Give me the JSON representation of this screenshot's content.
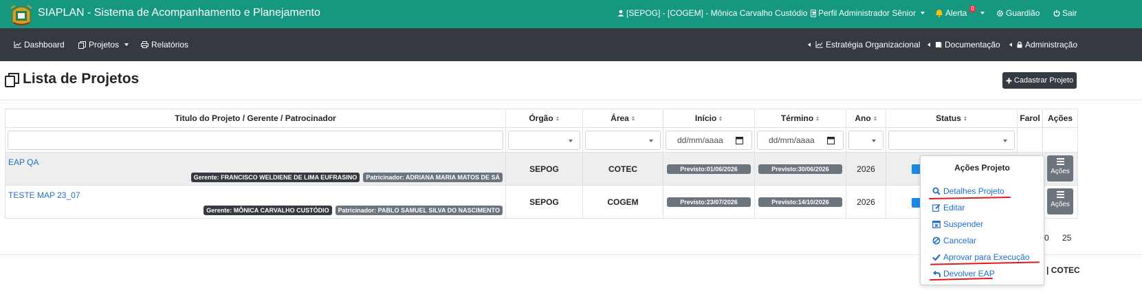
{
  "topbar": {
    "app_title": "SIAPLAN - Sistema de Acompanhamento e Planejamento",
    "user": "[SEPOG] - [COGEM] - Mônica Carvalho Custódio",
    "profile": "Perfil Administrador Sênior",
    "alert": "Alerta",
    "alert_count": "0",
    "guardiao": "Guardião",
    "exit": "Sair"
  },
  "navbar": {
    "dashboard": "Dashboard",
    "projetos": "Projetos",
    "relatorios": "Relatórios",
    "estrategia": "Estratégia Organizacional",
    "documentacao": "Documentação",
    "administracao": "Administração"
  },
  "page": {
    "title": "Lista de Projetos",
    "add_button": "Cadastrar Projeto"
  },
  "table": {
    "headers": [
      "Titulo do Projeto / Gerente / Patrocinador",
      "Órgão",
      "Área",
      "Início",
      "Término",
      "Ano",
      "Status",
      "Farol",
      "Ações"
    ],
    "date_placeholder": "dd/mm/aaaa",
    "rows": [
      {
        "title": "EAP QA",
        "gerente": "Gerente: FRANCISCO WELDIENE DE LIMA EUFRASINO",
        "patrocinador": "Patricinador: ADRIANA MARIA MATOS DE SÁ",
        "orgao": "SEPOG",
        "area": "COTEC",
        "inicio": "Previsto:01/06/2026",
        "termino": "Previsto:30/06/2026",
        "ano": "2026",
        "acoes": "Ações"
      },
      {
        "title": "TESTE MAP 23_07",
        "gerente": "Gerente: MÔNICA CARVALHO CUSTÓDIO",
        "patrocinador": "Patricinador: PABLO SAMUEL SILVA DO NASCIMENTO",
        "orgao": "SEPOG",
        "area": "COGEM",
        "inicio": "Previsto:23/07/2026",
        "termino": "Previsto:14/10/2026",
        "ano": "2026",
        "acoes": "Ações"
      }
    ]
  },
  "dropdown": {
    "header": "Ações Projeto",
    "items": [
      "Detalhes Projeto",
      "Editar",
      "Suspender",
      "Cancelar",
      "Aprovar para Execução",
      "Devolver EAP"
    ]
  },
  "pagination": {
    "a": "0",
    "b": "25"
  },
  "footer": {
    "text": "| COTEC"
  },
  "colors": {
    "topbar": "#16977f",
    "navbar": "#343a40",
    "link": "#1e6fc9",
    "annotation": "#e0191b"
  }
}
